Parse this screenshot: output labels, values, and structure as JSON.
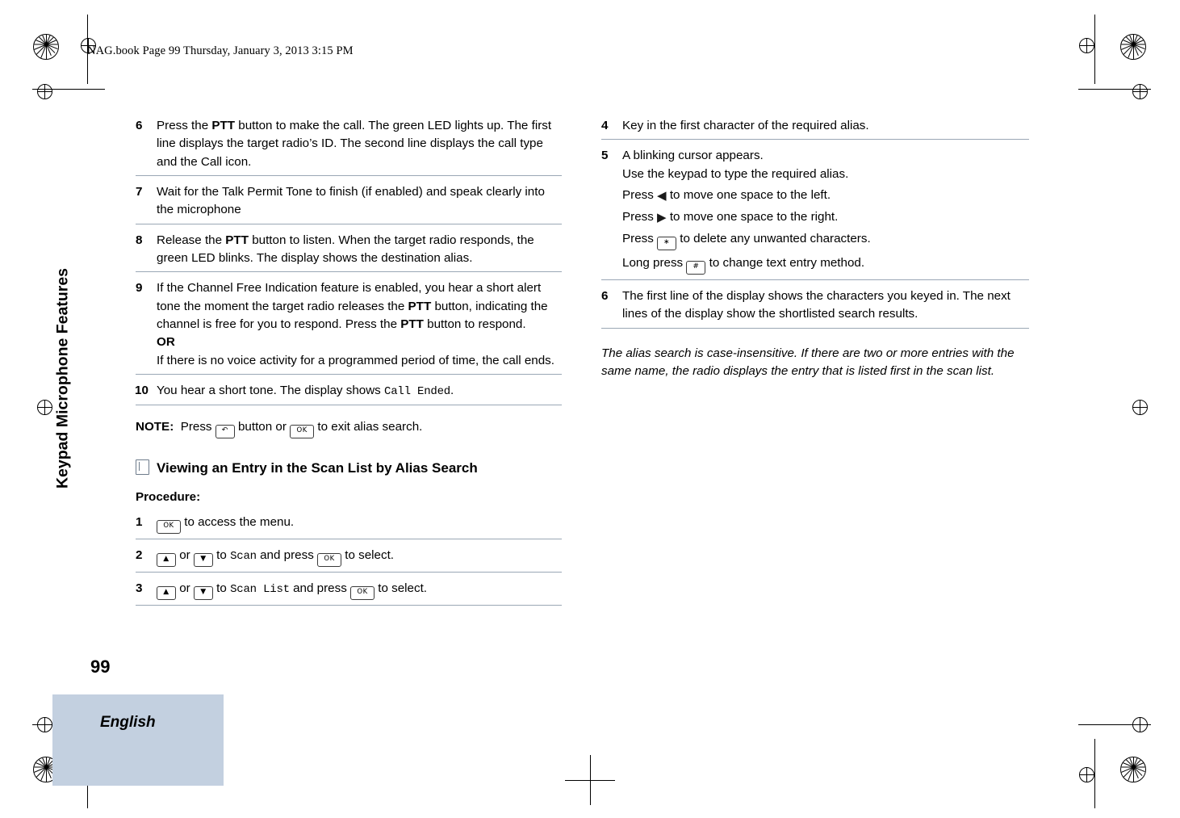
{
  "header": {
    "file_line": "NAG.book  Page 99  Thursday, January 3, 2013  3:15 PM"
  },
  "sidebar": {
    "chapter_title": "Keypad Microphone Features",
    "page_number": "99",
    "language_tab": "English"
  },
  "left_column": {
    "steps": [
      {
        "num": "6",
        "parts": [
          {
            "t": "Press the ",
            "s": "normal"
          },
          {
            "t": "PTT",
            "s": "bold"
          },
          {
            "t": " button to make the call. The green LED lights up. The first line displays the target radio’s ID. The second line displays the call type and the Call icon.",
            "s": "normal"
          }
        ]
      },
      {
        "num": "7",
        "parts": [
          {
            "t": "Wait for the Talk Permit Tone to finish (if enabled) and speak clearly into the microphone",
            "s": "normal"
          }
        ]
      },
      {
        "num": "8",
        "parts": [
          {
            "t": "Release the ",
            "s": "normal"
          },
          {
            "t": "PTT",
            "s": "bold"
          },
          {
            "t": " button to listen. When the target radio responds, the green LED blinks. The display shows the destination alias.",
            "s": "normal"
          }
        ]
      },
      {
        "num": "9",
        "parts": [
          {
            "t": "If the Channel Free Indication feature is enabled, you hear a short alert tone the moment the target radio releases the ",
            "s": "normal"
          },
          {
            "t": "PTT",
            "s": "bold"
          },
          {
            "t": " button, indicating the channel is free for you to respond. Press the ",
            "s": "normal"
          },
          {
            "t": "PTT",
            "s": "bold"
          },
          {
            "t": " button to respond.",
            "s": "normal"
          },
          {
            "t": "OR",
            "s": "bold-line"
          },
          {
            "t": "If there is no voice activity for a programmed period of time, the call ends.",
            "s": "normal-line"
          }
        ]
      },
      {
        "num": "10",
        "parts": [
          {
            "t": "You hear a short tone. The display shows ",
            "s": "normal"
          },
          {
            "t": "Call Ended",
            "s": "mono"
          },
          {
            "t": ".",
            "s": "normal"
          }
        ]
      }
    ],
    "note": {
      "label": "NOTE:",
      "before_key": "Press ",
      "key1": "back-key",
      "middle": " button or ",
      "key2": "menu-ok-key",
      "after": " to exit alias search."
    },
    "section_heading": "Viewing an Entry in the Scan List by Alias Search",
    "procedure_label": "Procedure:",
    "procedure_steps": [
      {
        "num": "1",
        "segments": [
          {
            "type": "key",
            "v": "menu-ok-key"
          },
          {
            "type": "text",
            "v": " to access the menu."
          }
        ]
      },
      {
        "num": "2",
        "segments": [
          {
            "type": "key",
            "v": "up-key"
          },
          {
            "type": "text",
            "v": " or "
          },
          {
            "type": "key",
            "v": "down-key"
          },
          {
            "type": "text",
            "v": " to "
          },
          {
            "type": "mono",
            "v": "Scan"
          },
          {
            "type": "text",
            "v": " and press "
          },
          {
            "type": "key",
            "v": "menu-ok-key"
          },
          {
            "type": "text",
            "v": " to select."
          }
        ]
      },
      {
        "num": "3",
        "segments": [
          {
            "type": "key",
            "v": "up-key"
          },
          {
            "type": "text",
            "v": " or "
          },
          {
            "type": "key",
            "v": "down-key"
          },
          {
            "type": "text",
            "v": " to "
          },
          {
            "type": "mono",
            "v": "Scan List"
          },
          {
            "type": "text",
            "v": " and press "
          },
          {
            "type": "key",
            "v": "menu-ok-key"
          },
          {
            "type": "text",
            "v": " to select."
          }
        ]
      }
    ]
  },
  "right_column": {
    "steps": [
      {
        "num": "4",
        "text": "Key in the first character of the required alias."
      },
      {
        "num": "5",
        "lines": [
          {
            "type": "text",
            "v": "A blinking cursor appears."
          },
          {
            "type": "text",
            "v": "Use the keypad to type the required alias."
          },
          {
            "type": "keyline",
            "before": "Press ",
            "key": "left-arrow",
            "after": " to move one space to the left."
          },
          {
            "type": "keyline",
            "before": "Press ",
            "key": "right-arrow",
            "after": " to move one space to the right."
          },
          {
            "type": "keyline",
            "before": "Press ",
            "key": "star-key",
            "after": " to delete any unwanted characters."
          },
          {
            "type": "keyline",
            "before": "Long press ",
            "key": "hash-key",
            "after": " to change text entry method."
          }
        ]
      },
      {
        "num": "6",
        "text": "The first line of the display shows the characters you keyed in. The next lines of the display show the shortlisted search results."
      }
    ],
    "italic_note": "The alias search is case-insensitive. If there are two or more entries with the same name, the radio displays the entry that is listed first in the scan list."
  },
  "keys": {
    "menu-ok-key": "OK",
    "back-key": "↶",
    "up-key": "▲",
    "down-key": "▼",
    "star-key": "∗",
    "hash-key": "#",
    "left-arrow": "◀",
    "right-arrow": "▶"
  },
  "colors": {
    "rule": "#9aa7b5",
    "tab_background": "#c3d0e0",
    "text": "#000000"
  }
}
